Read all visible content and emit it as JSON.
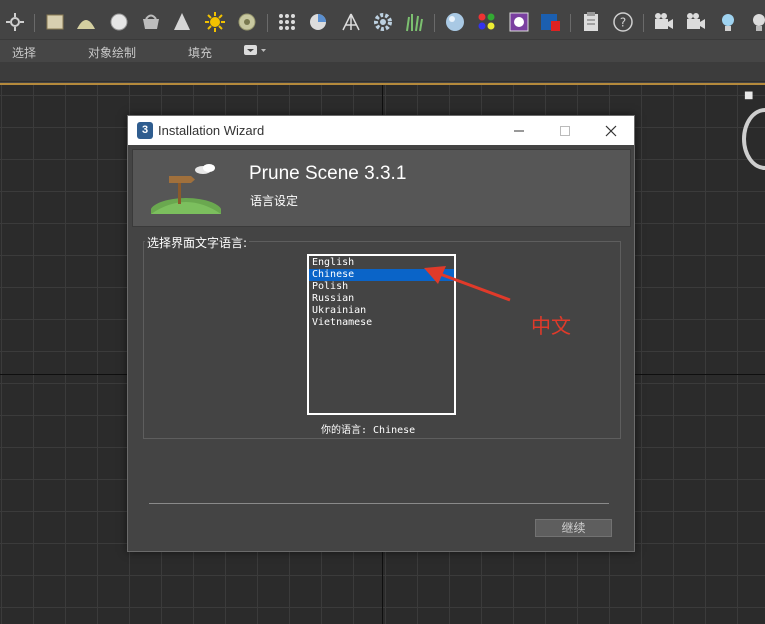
{
  "ribbon": {
    "items": [
      "选择",
      "对象绘制",
      "填充"
    ]
  },
  "toolbar": {
    "icons": [
      "selection-icon",
      "frame-icon",
      "dome-icon",
      "circle-icon",
      "basket-icon",
      "cone-icon",
      "sun-icon",
      "sphere-icon",
      "dots-icon",
      "pie-icon",
      "tripod-icon",
      "gear-icon",
      "grass-icon",
      "ball-icon",
      "palette-icon",
      "paint-icon",
      "render-icon",
      "clipboard-icon",
      "help-icon",
      "camera-icon",
      "camera-list-icon",
      "bulb-icon",
      "bulb-list-icon"
    ]
  },
  "wizard": {
    "title": "Installation Wizard",
    "app_icon_label": "3",
    "product_name": "Prune Scene 3.3.1",
    "subtitle": "语言设定",
    "group_label": "选择界面文字语言:",
    "languages": [
      "English",
      "Chinese",
      "Polish",
      "Russian",
      "Ukrainian",
      "Vietnamese"
    ],
    "selected_language": "Chinese",
    "current_language_text": "你的语言: Chinese",
    "continue_label": "继续"
  },
  "annotation": {
    "text": "中文",
    "color": "#e03a2a"
  },
  "colors": {
    "selection": "#0a64c8",
    "viewport": "#2b2b2b",
    "panel": "#444444"
  }
}
